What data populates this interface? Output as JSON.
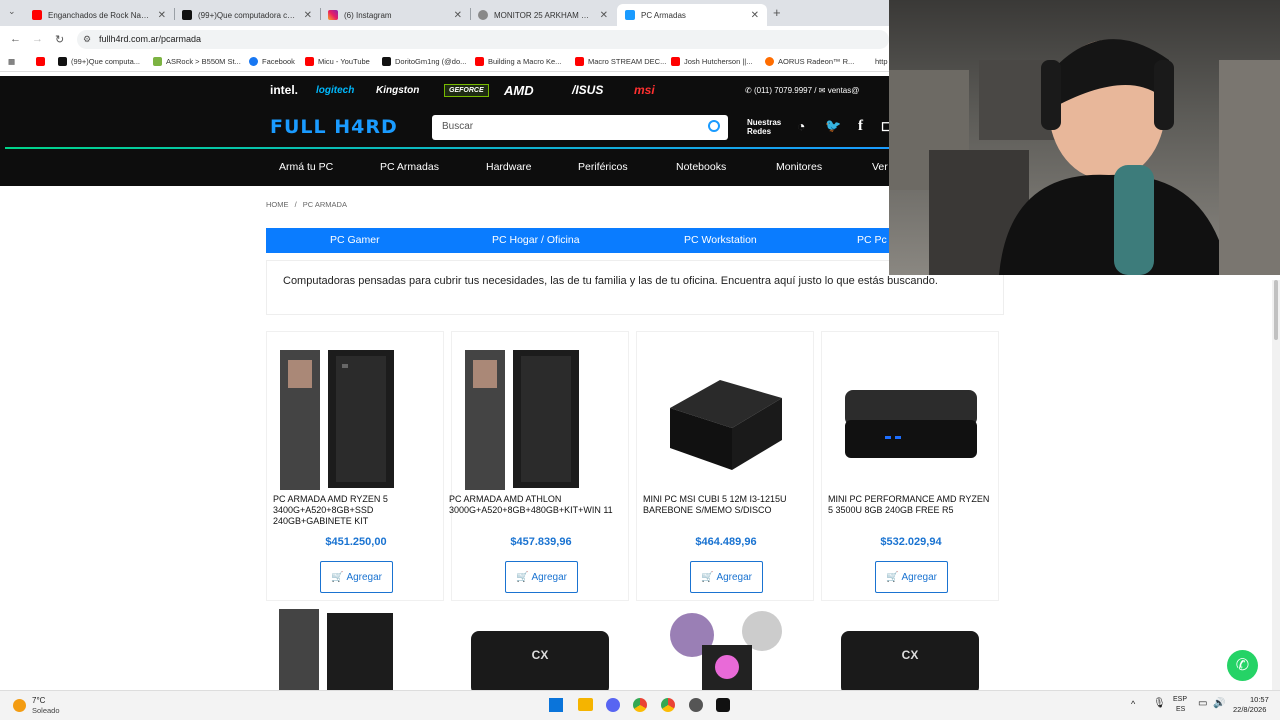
{
  "browser": {
    "tabs": [
      {
        "title": "Enganchados de Rock Nacional",
        "icon": "youtube-icon"
      },
      {
        "title": "(99+)Que computadora comprar",
        "icon": "tiktok-icon"
      },
      {
        "title": "(6) Instagram",
        "icon": "instagram-icon"
      },
      {
        "title": "MONITOR 25 ARKHAM GAMER",
        "icon": "site-icon"
      },
      {
        "title": "PC Armadas",
        "icon": "fullh4rd-icon",
        "active": true
      }
    ],
    "url": "fullh4rd.com.ar/pcarmada",
    "bookmarks": [
      "(99+)Que computa...",
      "ASRock > B550M St...",
      "Facebook",
      "Micu - YouTube",
      "DoritoGm1ng (@do...",
      "Building a Macro Ke...",
      "Macro STREAM DEC...",
      "Josh Hutcherson ||...",
      "AORUS Radeon™ R...",
      "http"
    ]
  },
  "site": {
    "brands": [
      "intel.",
      "logitech",
      "Kingston",
      "GEFORCE",
      "AMD",
      "/ISUS",
      "msi"
    ],
    "phone": "(011) 7079.9997",
    "email": "ventas@",
    "logo": "FULL H4RD",
    "search_placeholder": "Buscar",
    "redes_label": "Nuestras Redes",
    "menu": [
      "Armá tu PC",
      "PC Armadas",
      "Hardware",
      "Periféricos",
      "Notebooks",
      "Monitores",
      "Ver"
    ],
    "breadcrumb": [
      "HOME",
      "/",
      "PC ARMADA"
    ],
    "categories": [
      "PC Gamer",
      "PC Hogar / Oficina",
      "PC Workstation",
      "PC Pc"
    ],
    "intro": "Computadoras pensadas para cubrir tus necesidades, las de tu familia y las de tu oficina. Encuentra aquí justo lo que estás buscando.",
    "products": [
      {
        "name": "PC ARMADA AMD RYZEN 5 3400G+A520+8GB+SSD 240GB+GABINETE KIT",
        "price": "$451.250,00",
        "button": "Agregar"
      },
      {
        "name": "PC ARMADA AMD ATHLON 3000G+A520+8GB+480GB+KIT+WIN 11",
        "price": "$457.839,96",
        "button": "Agregar"
      },
      {
        "name": "MINI PC MSI CUBI 5 12M I3-1215U BAREBONE S/MEMO S/DISCO",
        "price": "$464.489,96",
        "button": "Agregar"
      },
      {
        "name": "MINI PC PERFORMANCE AMD RYZEN 5 3500U 8GB 240GB FREE R5",
        "price": "$532.029,94",
        "button": "Agregar"
      }
    ]
  },
  "taskbar": {
    "weather_temp": "7°C",
    "weather_desc": "Soleado",
    "lang1": "ESP",
    "lang2": "ES",
    "time": "10:57",
    "date": "22/8/2026"
  }
}
